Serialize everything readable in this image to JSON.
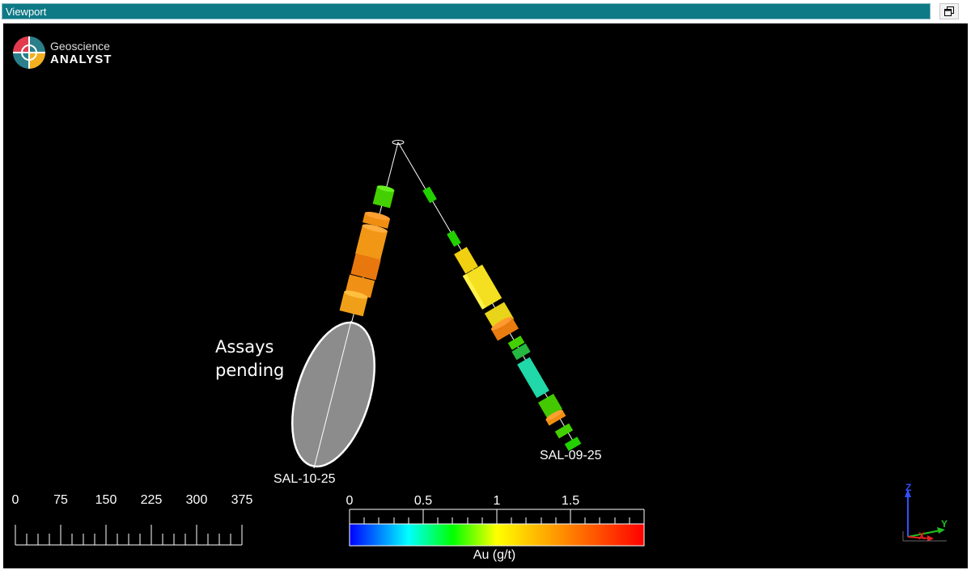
{
  "window": {
    "title": "Viewport",
    "restore_icon": "restore-window-icon"
  },
  "logo": {
    "line1": "Geoscience",
    "line2": "ANALYST"
  },
  "annotation": {
    "line1": "Assays",
    "line2": "pending"
  },
  "drillholes": [
    {
      "label": "SAL-10-25"
    },
    {
      "label": "SAL-09-25"
    }
  ],
  "scale_bar": {
    "ticks": [
      "0",
      "75",
      "150",
      "225",
      "300",
      "375"
    ]
  },
  "colorbar": {
    "title": "Au (g/t)",
    "ticks": [
      "0",
      "0.5",
      "1",
      "1.5"
    ],
    "min": 0,
    "max": 2,
    "colors": [
      "#0000ff",
      "#00ffff",
      "#00ff00",
      "#ffff00",
      "#ff8000",
      "#ff0000"
    ]
  },
  "triad": {
    "z": "Z",
    "y": "Y",
    "x": "X"
  },
  "colors": {
    "titlebar": "#0e7a86",
    "background": "#000000",
    "pending_ellipse": "#8c8c8c"
  }
}
